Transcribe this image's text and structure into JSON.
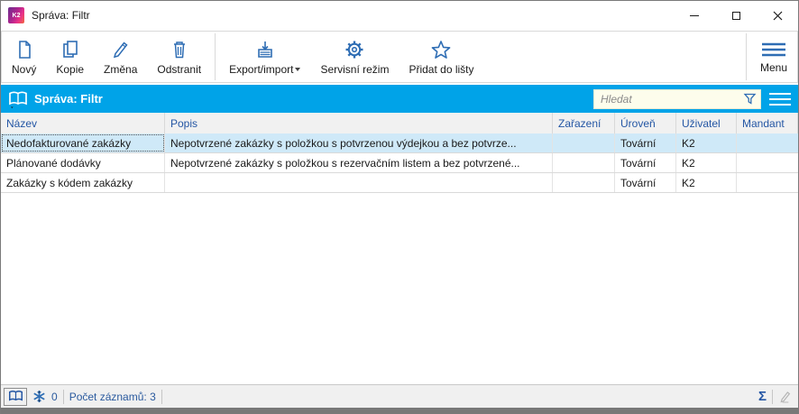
{
  "window": {
    "app_icon_text": "K2",
    "title": "Správa: Filtr"
  },
  "toolbar": {
    "buttons": [
      {
        "label": "Nový",
        "icon": "new-document-icon"
      },
      {
        "label": "Kopie",
        "icon": "copy-icon"
      },
      {
        "label": "Změna",
        "icon": "edit-pencil-icon"
      },
      {
        "label": "Odstranit",
        "icon": "trash-icon"
      },
      {
        "label": "Export/import",
        "icon": "export-import-icon",
        "has_dropdown": true
      },
      {
        "label": "Servisní režim",
        "icon": "gear-icon"
      },
      {
        "label": "Přidat do lišty",
        "icon": "star-icon"
      },
      {
        "label": "Menu",
        "icon": "hamburger-icon"
      }
    ]
  },
  "panel": {
    "title": "Správa: Filtr",
    "search_placeholder": "Hledat"
  },
  "table": {
    "columns": [
      "Název",
      "Popis",
      "Zařazení",
      "Úroveň",
      "Uživatel",
      "Mandant"
    ],
    "rows": [
      [
        "Nedofakturované zakázky",
        "Nepotvrzené zakázky s položkou s potvrzenou výdejkou a bez potvrze...",
        "",
        "Tovární",
        "K2",
        ""
      ],
      [
        "Plánované dodávky",
        "Nepotvrzené zakázky s položkou s rezervačním listem a bez potvrzené...",
        "",
        "Tovární",
        "K2",
        ""
      ],
      [
        "Zakázky s kódem zakázky",
        "",
        "",
        "Tovární",
        "K2",
        ""
      ]
    ],
    "selected_row_index": 0
  },
  "statusbar": {
    "counter": "0",
    "record_count": "Počet záznamů: 3",
    "sigma": "Σ"
  },
  "colors": {
    "accent_cyan": "#00a3e8",
    "icon_blue": "#2e6db4",
    "header_text_blue": "#2456a4",
    "selected_row": "#cfe9f8",
    "search_bg": "#fdfdec"
  }
}
